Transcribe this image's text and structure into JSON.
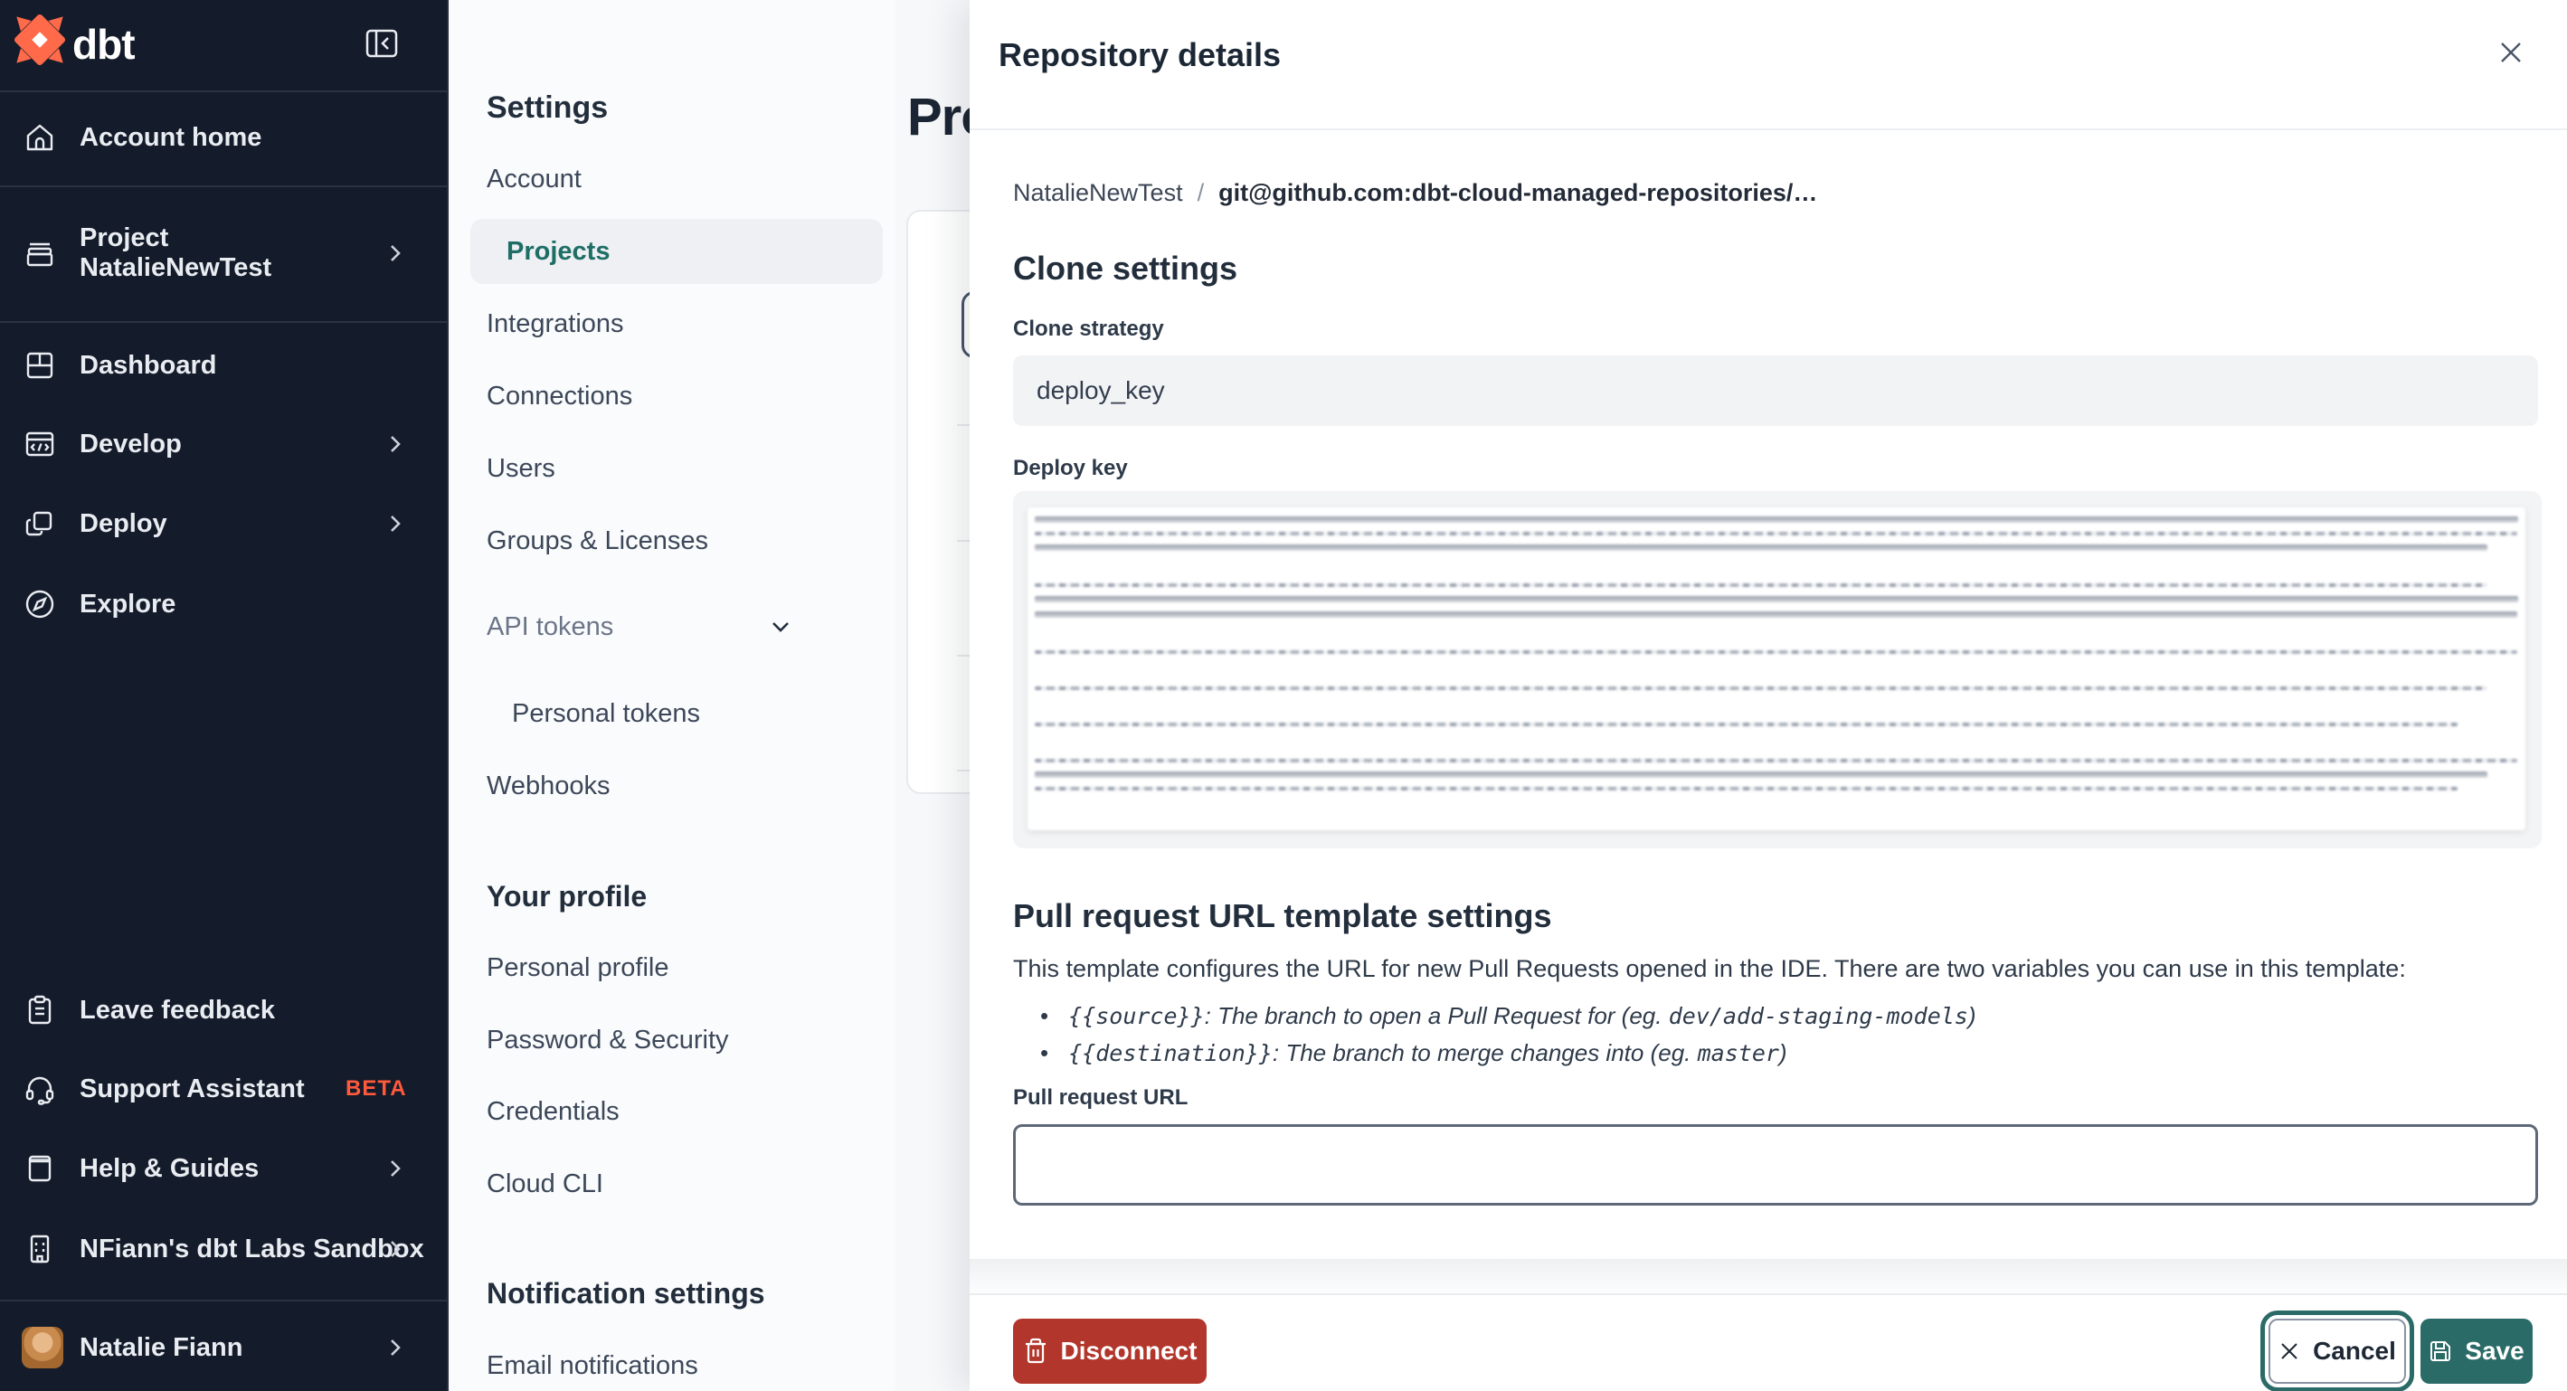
{
  "brand": {
    "name": "dbt"
  },
  "sidebar": {
    "items": [
      {
        "label": "Account home"
      },
      {
        "label": "Project",
        "sublabel": "NatalieNewTest"
      },
      {
        "label": "Dashboard"
      },
      {
        "label": "Develop"
      },
      {
        "label": "Deploy"
      },
      {
        "label": "Explore"
      }
    ],
    "footer_items": [
      {
        "label": "Leave feedback"
      },
      {
        "label": "Support Assistant",
        "badge": "BETA"
      },
      {
        "label": "Help & Guides"
      },
      {
        "label": "NFiann's dbt Labs Sandbox"
      }
    ],
    "user": {
      "name": "Natalie Fiann"
    }
  },
  "settings_nav": {
    "title": "Settings",
    "items": [
      {
        "label": "Account"
      },
      {
        "label": "Projects",
        "active": true
      },
      {
        "label": "Integrations"
      },
      {
        "label": "Connections"
      },
      {
        "label": "Users"
      },
      {
        "label": "Groups & Licenses"
      },
      {
        "label": "API tokens",
        "expandable": true
      }
    ],
    "sub_items": [
      {
        "label": "Personal tokens"
      },
      {
        "label": "Webhooks"
      }
    ],
    "profile_section": {
      "title": "Your profile",
      "items": [
        {
          "label": "Personal profile"
        },
        {
          "label": "Password & Security"
        },
        {
          "label": "Credentials"
        },
        {
          "label": "Cloud CLI"
        }
      ]
    },
    "notification_section": {
      "title": "Notification settings",
      "items": [
        {
          "label": "Email notifications"
        }
      ]
    }
  },
  "main": {
    "title": "Projects"
  },
  "panel": {
    "title": "Repository details",
    "breadcrumb": {
      "project": "NatalieNewTest",
      "separator": "/",
      "repo": "git@github.com:dbt-cloud-managed-repositories/…"
    },
    "clone_settings": {
      "heading": "Clone settings",
      "strategy_label": "Clone strategy",
      "strategy_value": "deploy_key",
      "deploy_key_label": "Deploy key"
    },
    "pr_template": {
      "heading": "Pull request URL template settings",
      "description": "This template configures the URL for new Pull Requests opened in the IDE. There are two variables you can use in this template:",
      "bullets": [
        {
          "code": "{{source}}",
          "text": ": The branch to open a Pull Request for (eg. ",
          "example": "dev/add-staging-models",
          "suffix": ")"
        },
        {
          "code": "{{destination}}",
          "text": ": The branch to merge changes into (eg. ",
          "example": "master",
          "suffix": ")"
        }
      ],
      "url_label": "Pull request URL",
      "url_value": ""
    },
    "footer": {
      "disconnect_label": "Disconnect",
      "cancel_label": "Cancel",
      "save_label": "Save"
    }
  },
  "colors": {
    "sidebar_bg": "#141b2a",
    "brand_orange": "#ff6a4b",
    "beta_orange": "#ff5a3c",
    "accent_teal": "#2a6b68",
    "active_item_teal": "#1f6e66",
    "danger_red": "#b2362b",
    "heading_navy": "#232e3d",
    "panel_bg": "#ffffff",
    "content_bg": "#f7f8fa"
  }
}
